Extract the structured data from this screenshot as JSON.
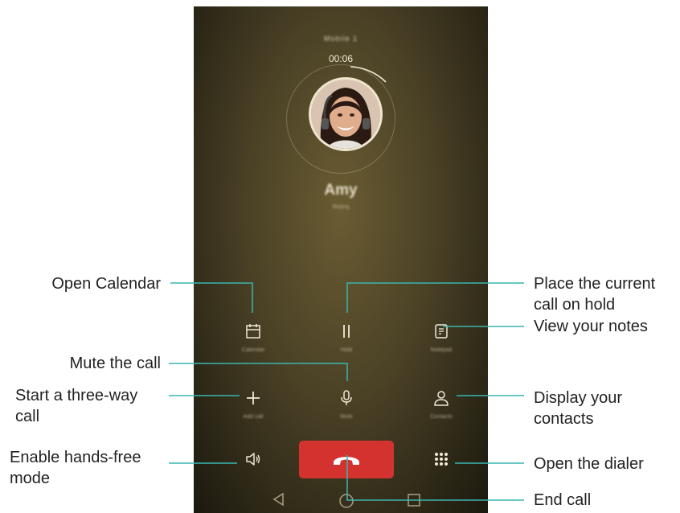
{
  "call": {
    "carrier": "Mobile 1",
    "timer": "00:06",
    "contact_name": "Amy",
    "contact_sub": "Beijing"
  },
  "buttons": {
    "calendar": "Calendar",
    "hold": "Hold",
    "notes": "Notepad",
    "add_call": "Add call",
    "mute": "Mute",
    "contacts": "Contacts"
  },
  "colors": {
    "callout_line": "#3ab5b0",
    "end_call": "#d3322f"
  },
  "annotations": {
    "open_calendar": "Open Calendar",
    "hold_1": "Place the current",
    "hold_2": "call on hold",
    "notes": "View your notes",
    "mute": "Mute the call",
    "three_way_1": "Start a three-way",
    "three_way_2": "call",
    "contacts_1": "Display your",
    "contacts_2": "contacts",
    "handsfree_1": "Enable hands-free",
    "handsfree_2": "mode",
    "dialer": "Open the dialer",
    "end_call": "End call"
  }
}
